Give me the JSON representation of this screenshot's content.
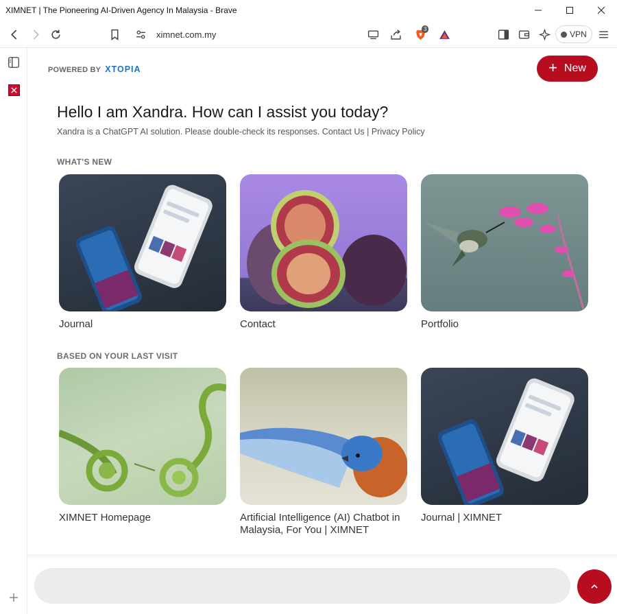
{
  "window": {
    "title": "XIMNET | The Pioneering AI-Driven Agency In Malaysia - Brave"
  },
  "browser": {
    "url": "ximnet.com.my",
    "vpn_label": "VPN",
    "shields_count": "3"
  },
  "header": {
    "powered_by": "POWERED BY",
    "brand": "XTOPIA",
    "new_button_label": "New"
  },
  "intro": {
    "greeting": "Hello I am Xandra. How can I assist you today?",
    "disclaimer_prefix": "Xandra is a ChatGPT AI solution. Please double-check its responses. ",
    "contact_link": "Contact Us",
    "separator": " | ",
    "privacy_link": "Privacy Policy"
  },
  "sections": {
    "whats_new": {
      "heading": "WHAT'S NEW",
      "cards": [
        {
          "label": "Journal",
          "image": "phone-mockup"
        },
        {
          "label": "Contact",
          "image": "figs"
        },
        {
          "label": "Portfolio",
          "image": "hummingbird"
        }
      ]
    },
    "last_visit": {
      "heading": "BASED ON YOUR LAST VISIT",
      "cards": [
        {
          "label": "XIMNET Homepage",
          "image": "fern-fronds"
        },
        {
          "label": "Artificial Intelligence (AI) Chatbot in Malaysia, For You | XIMNET",
          "image": "bluebird"
        },
        {
          "label": "Journal | XIMNET",
          "image": "phone-mockup"
        }
      ]
    }
  },
  "chat": {
    "input_value": "",
    "placeholder": ""
  },
  "colors": {
    "accent": "#b80c1f",
    "brand_blue": "#1e73be",
    "input_bg": "#ececec"
  }
}
